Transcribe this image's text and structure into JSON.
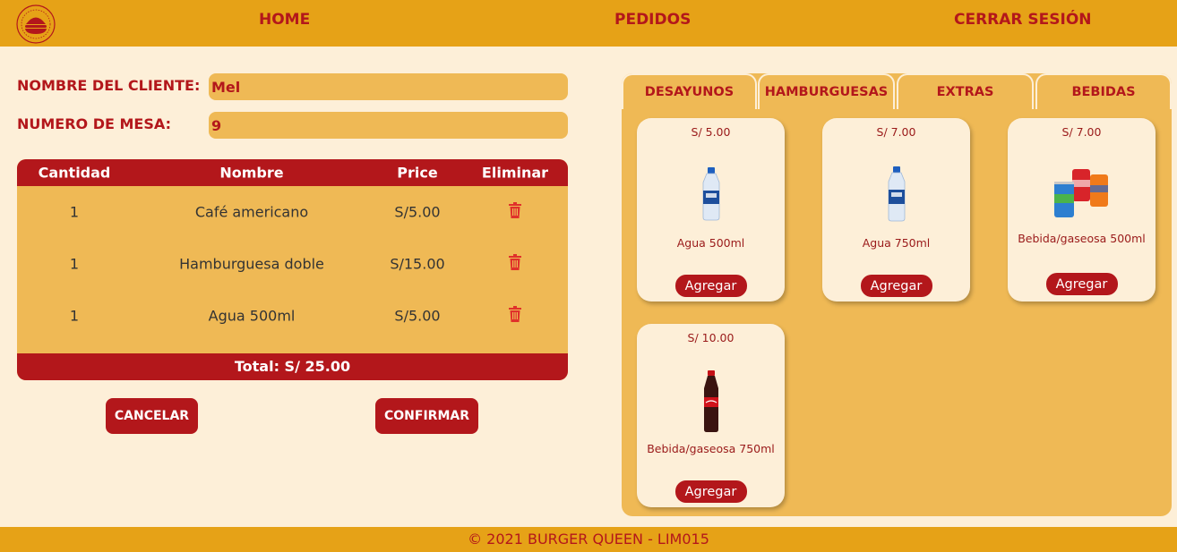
{
  "nav": {
    "home": "HOME",
    "pedidos": "PEDIDOS",
    "logout": "CERRAR SESIÓN"
  },
  "form": {
    "client_label": "NOMBRE DEL CLIENTE:",
    "client_value": "Mel",
    "table_label": "NUMERO DE MESA:",
    "table_value": "9"
  },
  "order": {
    "headers": {
      "qty": "Cantidad",
      "name": "Nombre",
      "price": "Price",
      "delete": "Eliminar"
    },
    "rows": [
      {
        "qty": "1",
        "name": "Café americano",
        "price": "S/5.00"
      },
      {
        "qty": "1",
        "name": "Hamburguesa doble",
        "price": "S/15.00"
      },
      {
        "qty": "1",
        "name": "Agua 500ml",
        "price": "S/5.00"
      }
    ],
    "total": "Total: S/ 25.00"
  },
  "actions": {
    "cancel": "CANCELAR",
    "confirm": "CONFIRMAR"
  },
  "tabs": [
    "DESAYUNOS",
    "HAMBURGUESAS",
    "EXTRAS",
    "BEBIDAS"
  ],
  "products": [
    {
      "price": "S/ 5.00",
      "name": "Agua 500ml",
      "button": "Agregar",
      "image": "water-bottle-icon"
    },
    {
      "price": "S/ 7.00",
      "name": "Agua 750ml",
      "button": "Agregar",
      "image": "water-bottle-icon"
    },
    {
      "price": "S/ 7.00",
      "name": "Bebida/gaseosa 500ml",
      "button": "Agregar",
      "image": "soda-cans-icon"
    },
    {
      "price": "S/ 10.00",
      "name": "Bebida/gaseosa 750ml",
      "button": "Agregar",
      "image": "cola-bottle-icon"
    }
  ],
  "footer": "© 2021 BURGER QUEEN - LIM015",
  "colors": {
    "header": "#e6a217",
    "accent": "#b3171b",
    "panel": "#efb955",
    "background": "#fdefd8"
  }
}
